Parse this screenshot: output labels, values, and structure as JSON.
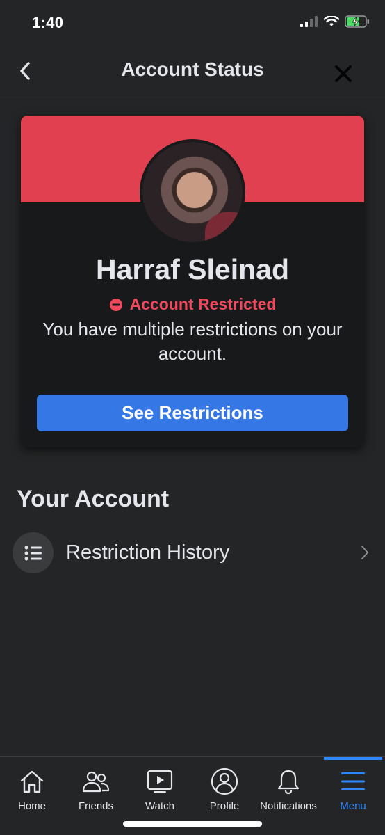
{
  "status_bar": {
    "time": "1:40"
  },
  "header": {
    "title": "Account Status",
    "back_icon": "chevron-left-icon",
    "close_icon": "close-icon"
  },
  "card": {
    "banner_color": "#e0404f",
    "name": "Harraf Sleinad",
    "status_label": "Account Restricted",
    "status_color": "#f0485c",
    "description": "You have multiple restrictions on your account.",
    "button_label": "See Restrictions",
    "button_color": "#3578e5"
  },
  "your_account": {
    "title": "Your Account",
    "items": [
      {
        "label": "Restriction History",
        "icon": "list-icon"
      }
    ]
  },
  "tabs": [
    {
      "label": "Home",
      "icon": "home-icon",
      "active": false
    },
    {
      "label": "Friends",
      "icon": "friends-icon",
      "active": false
    },
    {
      "label": "Watch",
      "icon": "watch-icon",
      "active": false
    },
    {
      "label": "Profile",
      "icon": "profile-icon",
      "active": false
    },
    {
      "label": "Notifications",
      "icon": "bell-icon",
      "active": false
    },
    {
      "label": "Menu",
      "icon": "menu-icon",
      "active": true
    }
  ],
  "accent_color": "#2d88ff"
}
